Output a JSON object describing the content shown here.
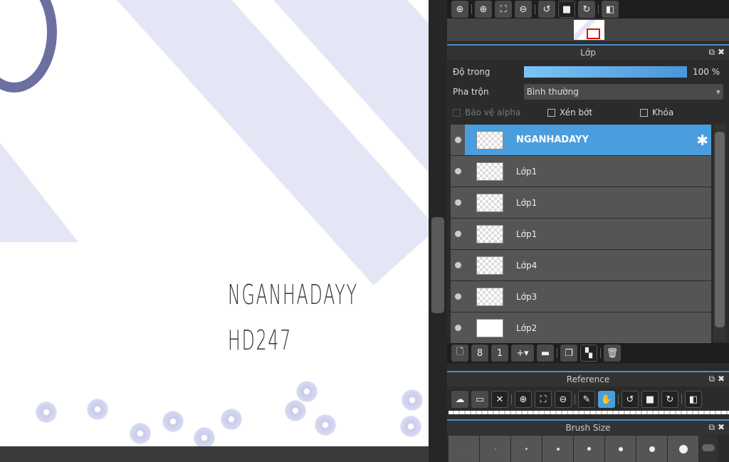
{
  "canvas": {
    "text_line1": "NGANHADAYY",
    "text_line2": "HD247"
  },
  "nav_toolbar": {
    "icons": [
      "zoom-actual-icon",
      "zoom-in-icon",
      "fit-icon",
      "zoom-out-icon",
      "rotate-left-icon",
      "reset-rotate-icon",
      "rotate-right-icon",
      "flip-icon"
    ]
  },
  "layer_panel": {
    "title": "Lớp",
    "opacity_label": "Độ trong",
    "opacity_value": "100 %",
    "opacity_percent": 100,
    "blend_label": "Pha trộn",
    "blend_value": "Bình thường",
    "protect_alpha": "Bảo vệ alpha",
    "clipping": "Xén bớt",
    "lock": "Khóa",
    "layers": [
      {
        "name": "NGANHADAYY",
        "selected": true
      },
      {
        "name": "Lớp1"
      },
      {
        "name": "Lớp1"
      },
      {
        "name": "Lớp1"
      },
      {
        "name": "Lớp4"
      },
      {
        "name": "Lớp3"
      },
      {
        "name": "Lớp2"
      }
    ]
  },
  "reference_panel": {
    "title": "Reference"
  },
  "brush_panel": {
    "title": "Brush Size"
  },
  "colors": {
    "accent": "#4a9ede",
    "stripe": "#e4e6f5"
  }
}
